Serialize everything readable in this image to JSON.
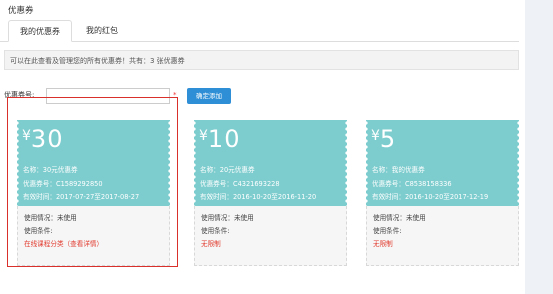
{
  "page": {
    "title": "优惠券"
  },
  "tabs": [
    {
      "label": "我的优惠券",
      "active": true
    },
    {
      "label": "我的红包",
      "active": false
    }
  ],
  "notice": "可以在此查看及管理您的所有优惠券！共有：3 张优惠券",
  "add_form": {
    "label": "优惠券号:",
    "value": "",
    "required_mark": "*",
    "button_label": "确定添加"
  },
  "colors": {
    "card": "#7dccce",
    "link": "#e23b2e",
    "button": "#2e8fd6",
    "highlight": "#d9302b"
  },
  "coupons": [
    {
      "currency": "¥",
      "amount": "30",
      "name": "名称：30元优惠券",
      "code": "优惠券号：C1589292850",
      "validity": "有效时间：2017-07-27至2017-08-27",
      "status": "使用情况：未使用",
      "condition_label": "使用条件:",
      "condition": "在线课程分类（查看详情）"
    },
    {
      "currency": "¥",
      "amount": "10",
      "name": "名称：20元优惠券",
      "code": "优惠券号：C4321693228",
      "validity": "有效时间：2016-10-20至2016-11-20",
      "status": "使用情况：未使用",
      "condition_label": "使用条件:",
      "condition": "无限制"
    },
    {
      "currency": "¥",
      "amount": "5",
      "name": "名称：我的优惠券",
      "code": "优惠券号：C8538158336",
      "validity": "有效时间：2016-10-20至2017-12-19",
      "status": "使用情况：未使用",
      "condition_label": "使用条件:",
      "condition": "无限制"
    }
  ]
}
